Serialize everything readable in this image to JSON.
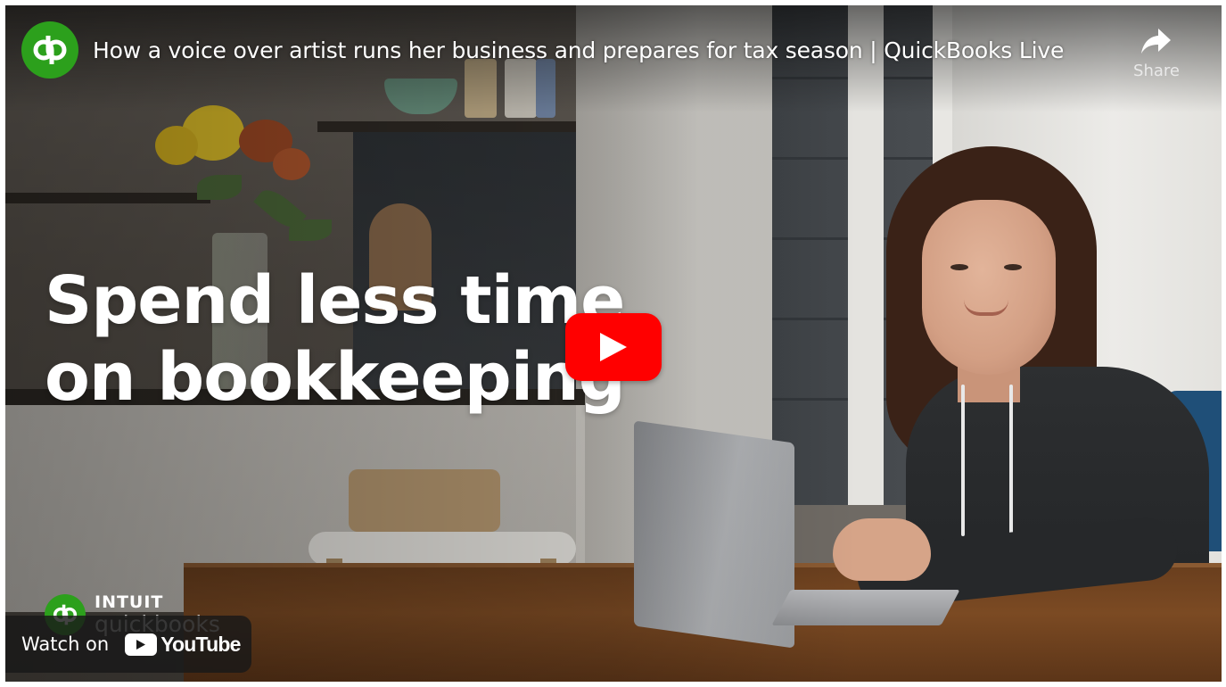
{
  "video": {
    "title": "How a voice over artist runs her business and prepares for tax season | QuickBooks Live",
    "headline_line1": "Spend less time",
    "headline_line2": "on bookkeeping"
  },
  "channel": {
    "avatar_icon": "quickbooks-logo-icon",
    "avatar_text": "qb",
    "brand_color": "#2ca01c"
  },
  "share": {
    "label": "Share",
    "icon": "share-arrow-icon"
  },
  "play_button": {
    "icon": "play-icon",
    "color": "#ff0000"
  },
  "brand": {
    "intuit": "INTUIT",
    "quickbooks": "quickbooks",
    "logo_text": "qb"
  },
  "watch_on": {
    "label": "Watch on",
    "platform": "YouTube",
    "icon": "youtube-logo-icon"
  }
}
